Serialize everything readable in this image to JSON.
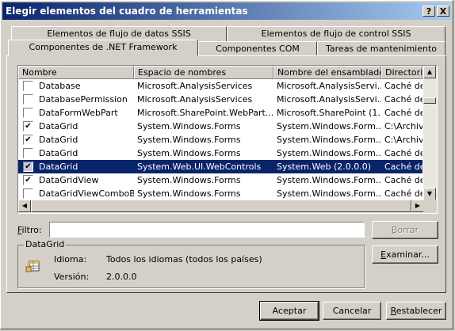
{
  "window": {
    "title": "Elegir elementos del cuadro de herramientas",
    "help_label": "?",
    "close_label": "X"
  },
  "tabs": {
    "top": [
      "Elementos de flujo de datos SSIS",
      "Elementos de flujo de control SSIS"
    ],
    "bottom": [
      "Componentes de .NET Framework",
      "Componentes COM",
      "Tareas de mantenimiento"
    ],
    "active": "Componentes de .NET Framework"
  },
  "list": {
    "columns": [
      "Nombre",
      "Espacio de nombres",
      "Nombre del ensamblado",
      "Directorio"
    ],
    "rows": [
      {
        "checked": false,
        "selected": false,
        "name": "Database",
        "namespace": "Microsoft.AnalysisServices",
        "assembly": "Microsoft.AnalysisServi...",
        "directory": "Caché de"
      },
      {
        "checked": false,
        "selected": false,
        "name": "DatabasePermission",
        "namespace": "Microsoft.AnalysisServices",
        "assembly": "Microsoft.AnalysisServi...",
        "directory": "Caché de"
      },
      {
        "checked": false,
        "selected": false,
        "name": "DataFormWebPart",
        "namespace": "Microsoft.SharePoint.WebPart...",
        "assembly": "Microsoft.SharePoint (1...",
        "directory": "Caché de"
      },
      {
        "checked": true,
        "selected": false,
        "name": "DataGrid",
        "namespace": "System.Windows.Forms",
        "assembly": "System.Windows.Form...",
        "directory": "C:\\Archivo"
      },
      {
        "checked": true,
        "selected": false,
        "name": "DataGrid",
        "namespace": "System.Windows.Forms",
        "assembly": "System.Windows.Form...",
        "directory": "C:\\Archivo"
      },
      {
        "checked": false,
        "selected": false,
        "name": "DataGrid",
        "namespace": "System.Windows.Forms",
        "assembly": "System.Windows.Form...",
        "directory": "Caché de"
      },
      {
        "checked": true,
        "selected": true,
        "name": "DataGrid",
        "namespace": "System.Web.UI.WebControls",
        "assembly": "System.Web (2.0.0.0)",
        "directory": "Caché de"
      },
      {
        "checked": true,
        "selected": false,
        "name": "DataGridView",
        "namespace": "System.Windows.Forms",
        "assembly": "System.Windows.Form...",
        "directory": "Caché de"
      },
      {
        "checked": false,
        "selected": false,
        "name": "DataGridViewComboB...",
        "namespace": "System.Windows.Forms",
        "assembly": "System.Windows.Form...",
        "directory": "Caché de"
      }
    ]
  },
  "filter": {
    "label_prefix": "",
    "label_underlined": "F",
    "label_rest": "iltro:",
    "value": "",
    "clear_button_prefix": "",
    "clear_button_underlined": "B",
    "clear_button_rest": "orrar"
  },
  "details": {
    "group_title": "DataGrid",
    "language_label": "Idioma:",
    "language_value": "Todos los idiomas (todos los países)",
    "version_label": "Versión:",
    "version_value": "2.0.0.0",
    "browse_button_prefix": "",
    "browse_button_underlined": "E",
    "browse_button_rest": "xaminar..."
  },
  "buttons": {
    "accept": "Aceptar",
    "cancel": "Cancelar",
    "reset_prefix": "",
    "reset_underlined": "R",
    "reset_rest": "establecer"
  }
}
